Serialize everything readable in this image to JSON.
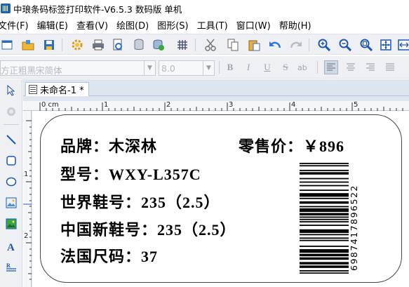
{
  "titlebar": {
    "title": "中琅条码标签打印软件-V6.5.3 数码版 单机"
  },
  "menu": [
    "文件(F)",
    "编辑(E)",
    "查看(V)",
    "绘图(D)",
    "图形(S)",
    "工具(T)",
    "窗口(W)",
    "帮助(H)"
  ],
  "toolbar": {
    "icons": [
      "new-file-icon",
      "open-folder-icon",
      "save-icon",
      "settings-gear-icon",
      "print-icon",
      "print-preview-icon",
      "database-icon",
      "database-add-icon",
      "grid-icon",
      "cut-icon",
      "copy-icon",
      "paste-icon",
      "undo-icon",
      "redo-icon",
      "zoom-in-icon",
      "zoom-out-icon",
      "zoom-fit-icon",
      "fit-page-icon"
    ]
  },
  "format_bar": {
    "font_name": "方正粗黑宋简体",
    "font_size": "8.0",
    "bold": "B",
    "italic": "I",
    "underline": "U",
    "strike": "S"
  },
  "left_tools": [
    "select-arrow-icon",
    "pan-hand-icon",
    "line-tool-icon",
    "rectangle-tool-icon",
    "ellipse-tool-icon",
    "image-tool-icon",
    "picture-tool-icon",
    "text-tool-icon",
    "rich-text-tool-icon"
  ],
  "tab": {
    "label": "未命名-1 *"
  },
  "ruler": {
    "h_labels": [
      "0 cm",
      "1",
      "2",
      "3",
      "4",
      "5"
    ],
    "v_labels": [
      "1",
      "2"
    ]
  },
  "label_content": {
    "brand": "品牌：木深林",
    "price": "零售价：￥896",
    "model": "型号：WXY-L357C",
    "world_size": "世界鞋号：235（2.5）",
    "china_size": "中国新鞋号：235（2.5）",
    "france_size": "法国尺码：37",
    "barcode_value": "6987417896522"
  }
}
